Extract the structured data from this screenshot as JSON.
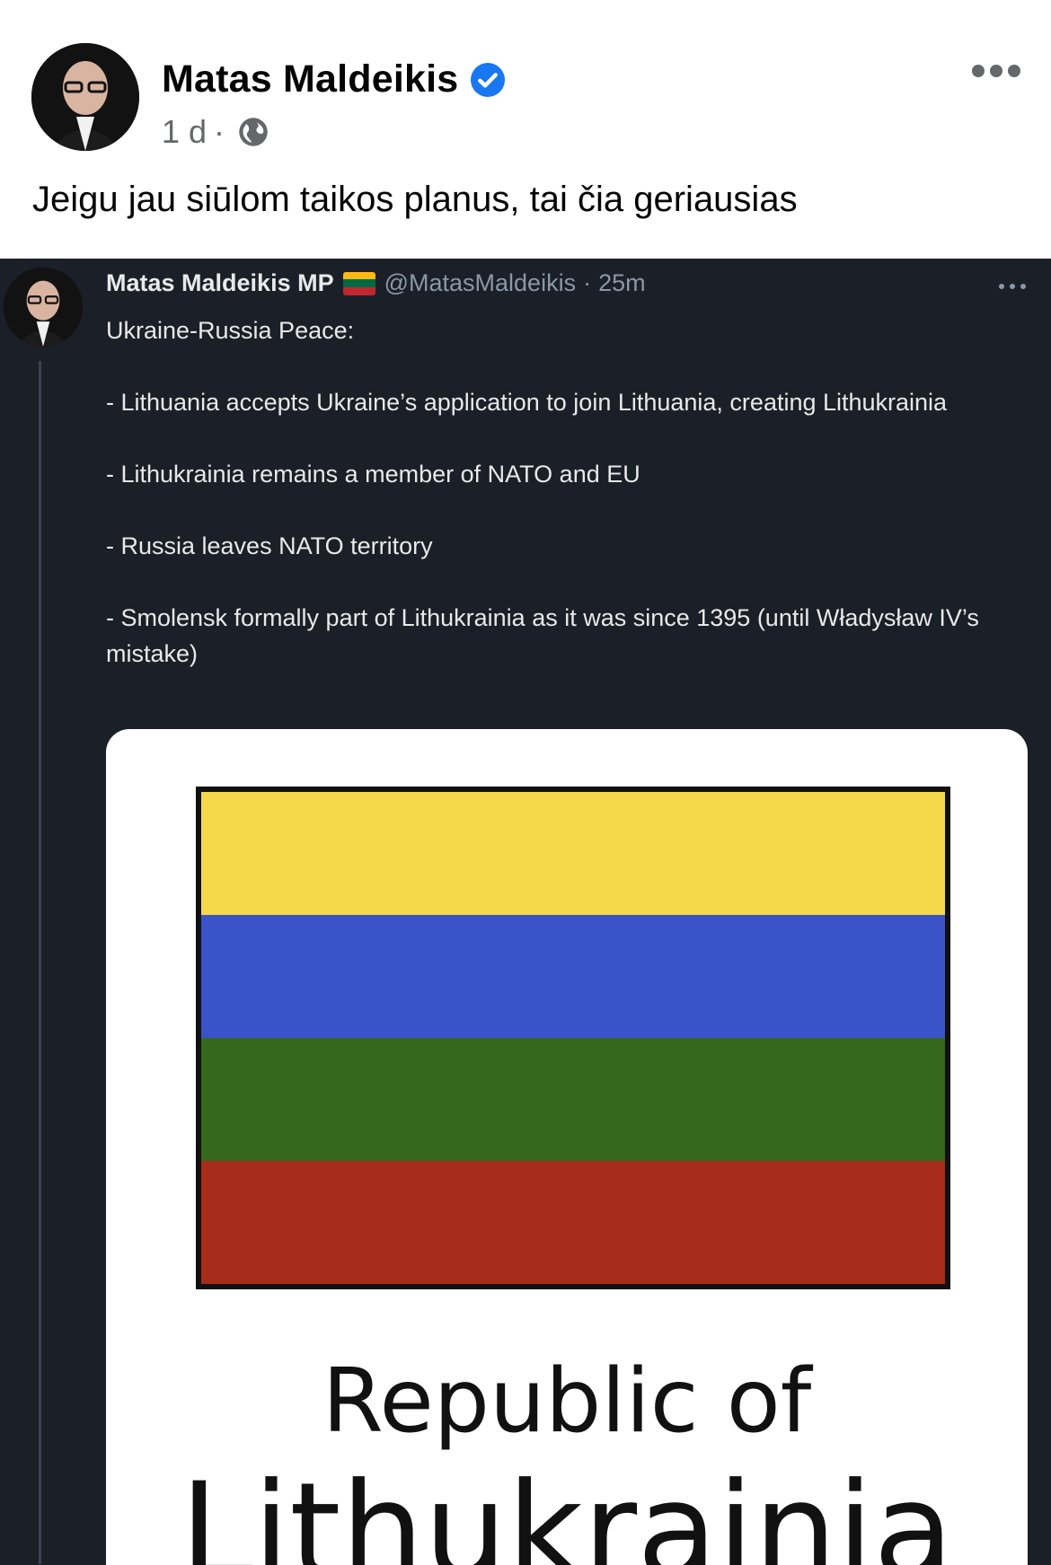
{
  "post": {
    "author": "Matas Maldeikis",
    "time": "1 d",
    "separator": "·",
    "privacy_icon": "globe-icon",
    "text": "Jeigu jau siūlom taikos planus, tai čia geriausias"
  },
  "tweet": {
    "author": "Matas Maldeikis MP",
    "handle": "@MatasMaldeikis",
    "time_sep": "·",
    "time": "25m",
    "lines": [
      "Ukraine-Russia Peace:",
      "- Lithuania accepts Ukraine’s application to join Lithuania, creating Lithukrainia",
      "- Lithukrainia remains a member of NATO and EU",
      "- Russia leaves NATO territory",
      "- Smolensk formally part of Lithukrainia as it was since 1395 (until Władysław IV’s mistake)"
    ],
    "image": {
      "caption_line1": "Republic of",
      "caption_line2": "Lithukrainia",
      "flag_stripes": [
        "#f5d94a",
        "#3a53c9",
        "#35671d",
        "#a92b1a"
      ]
    }
  },
  "colors": {
    "verified": "#1877f2",
    "tweet_bg": "#1b1f27",
    "meta_gray": "#65676b"
  }
}
